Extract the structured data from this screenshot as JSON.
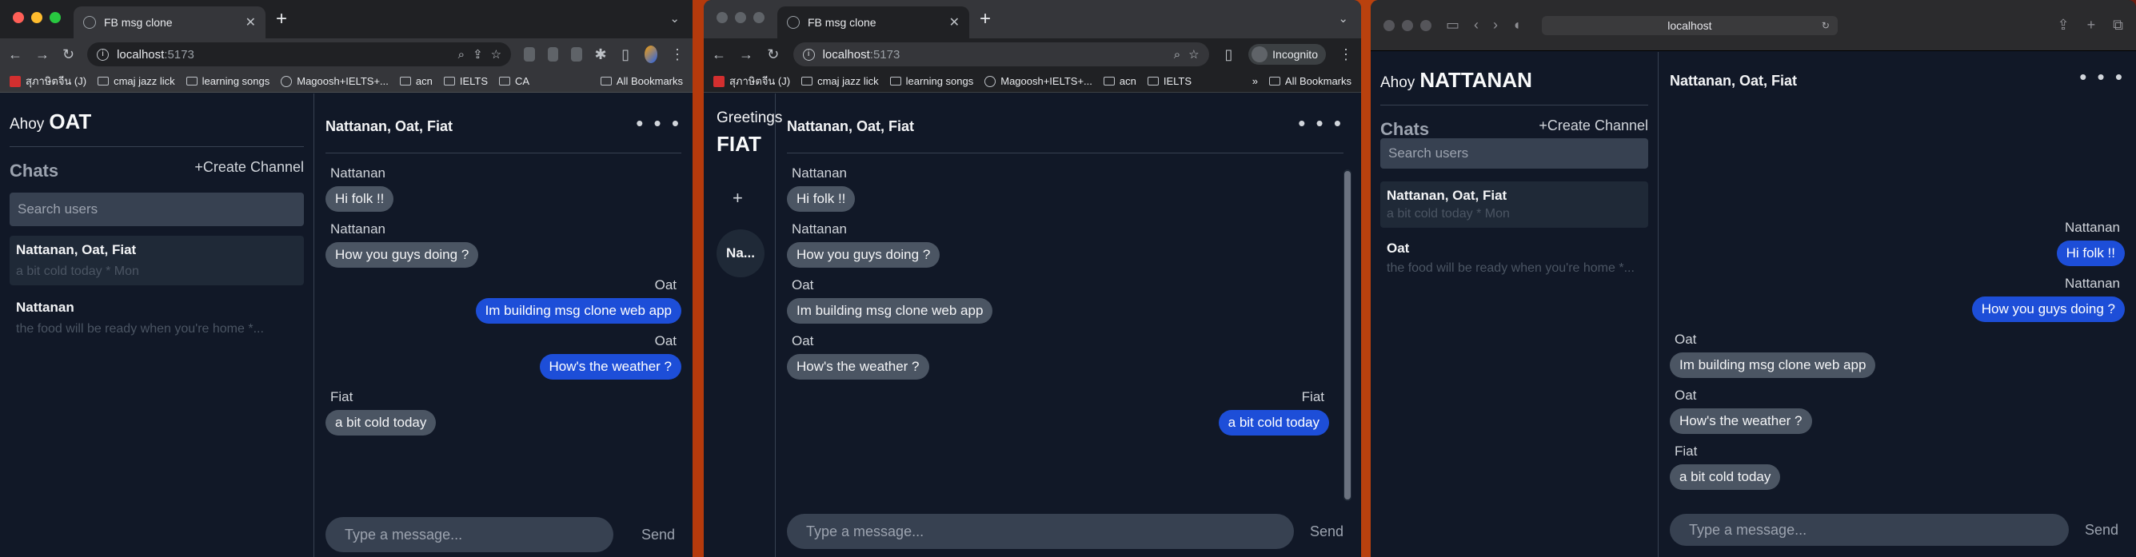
{
  "colors": {
    "bubble_out": "#1d4ed8",
    "bubble_in": "#4b5563",
    "app_bg": "#111827",
    "panel": "#1f2937"
  },
  "w1": {
    "tab_title": "FB msg clone",
    "url_host": "localhost",
    "url_port": ":5173",
    "bookmarks": [
      "สุภาษิตจีน (J)",
      "cmaj jazz lick",
      "learning songs",
      "Magoosh+IELTS+...",
      "acn",
      "IELTS",
      "CA"
    ],
    "all_bookmarks": "All Bookmarks",
    "greet_small": "Ahoy",
    "greet_name": "OAT",
    "chats_heading": "Chats",
    "create_label": "+Create Channel",
    "search_placeholder": "Search users",
    "chats": [
      {
        "name": "Nattanan, Oat, Fiat",
        "preview": "a bit cold today * Mon"
      },
      {
        "name": "Nattanan",
        "preview": "the food will be ready when you're home *..."
      }
    ],
    "conv_title": "Nattanan, Oat, Fiat",
    "more": "• • •",
    "messages": [
      {
        "sender": "Nattanan",
        "text": "Hi folk !!"
      },
      {
        "sender": "Nattanan",
        "text": "How you guys doing ?"
      },
      {
        "sender": "Oat",
        "text": "Im building msg clone web app"
      },
      {
        "sender": "Oat",
        "text": "How's the weather ?"
      },
      {
        "sender": "Fiat",
        "text": "a bit cold today"
      }
    ],
    "input_placeholder": "Type a message...",
    "send_label": "Send"
  },
  "w2": {
    "tab_title": "FB msg clone",
    "url_host": "localhost",
    "url_port": ":5173",
    "incognito": "Incognito",
    "bookmarks": [
      "สุภาษิตจีน (J)",
      "cmaj jazz lick",
      "learning songs",
      "Magoosh+IELTS+...",
      "acn",
      "IELTS"
    ],
    "overflow": "»",
    "all_bookmarks": "All Bookmarks",
    "greet_small": "Greetings",
    "greet_name": "FIAT",
    "plus": "+",
    "channel_abbrev": "Na...",
    "conv_title": "Nattanan, Oat, Fiat",
    "more": "• • •",
    "messages": [
      {
        "sender": "Nattanan",
        "text": "Hi folk !!"
      },
      {
        "sender": "Nattanan",
        "text": "How you guys doing ?"
      },
      {
        "sender": "Oat",
        "text": "Im building msg clone web app"
      },
      {
        "sender": "Oat",
        "text": "How's the weather ?"
      },
      {
        "sender": "Fiat",
        "text": "a bit cold today"
      }
    ],
    "input_placeholder": "Type a message...",
    "send_label": "Send"
  },
  "w3": {
    "url": "localhost",
    "greet_small": "Ahoy",
    "greet_name": "NATTANAN",
    "chats_heading": "Chats",
    "create_label": "+Create Channel",
    "search_placeholder": "Search users",
    "chats": [
      {
        "name": "Nattanan, Oat, Fiat",
        "preview": "a bit cold today * Mon"
      },
      {
        "name": "Oat",
        "preview": "the food will be ready when you're home *..."
      }
    ],
    "conv_title": "Nattanan, Oat, Fiat",
    "more": "• • •",
    "messages": [
      {
        "sender": "Nattanan",
        "text": "Hi folk !!"
      },
      {
        "sender": "Nattanan",
        "text": "How you guys doing ?"
      },
      {
        "sender": "Oat",
        "text": "Im building msg clone web app"
      },
      {
        "sender": "Oat",
        "text": "How's the weather ?"
      },
      {
        "sender": "Fiat",
        "text": "a bit cold today"
      }
    ],
    "input_placeholder": "Type a message...",
    "send_label": "Send"
  }
}
